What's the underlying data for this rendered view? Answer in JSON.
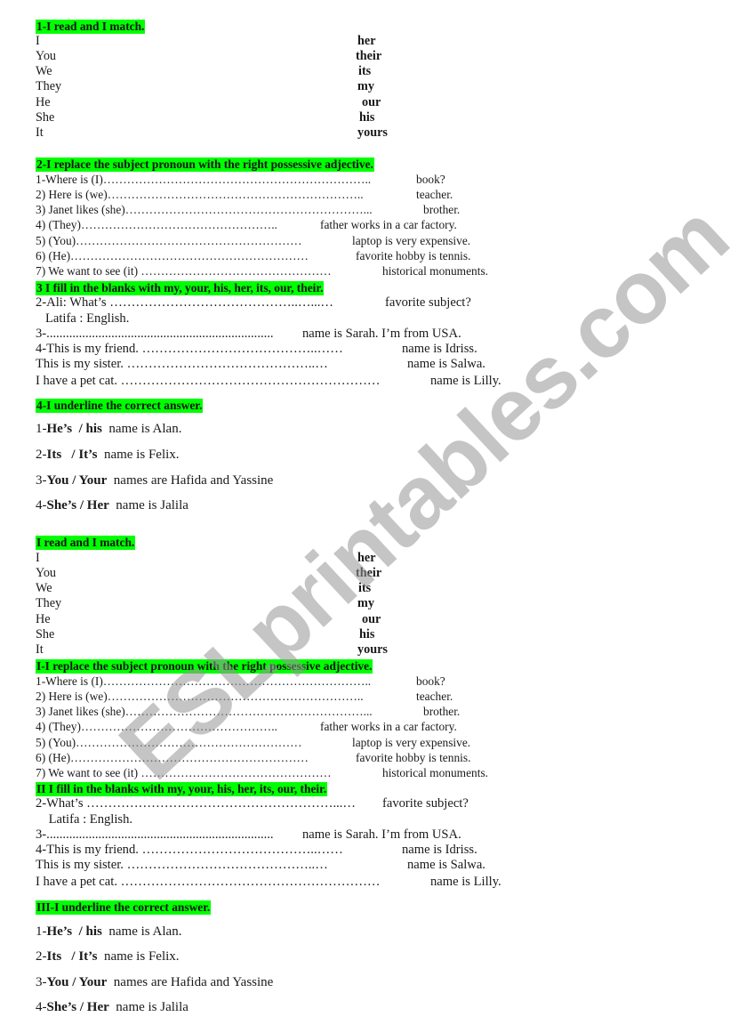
{
  "watermark": "ESLprintables.com",
  "colors": {
    "highlight": "#00ff00",
    "text": "#1a1a1a",
    "watermark": "#a0a0a0"
  },
  "part1": {
    "match": {
      "heading": "1-I read and I match.",
      "subjects": [
        "I",
        "You",
        "We",
        "They",
        "He",
        "She",
        "It"
      ],
      "possessives": [
        "her",
        "their",
        "its",
        "my",
        "our",
        "his",
        "yours"
      ]
    },
    "replace": {
      "heading": "2-I replace the subject pronoun with the right possessive adjective.",
      "items": [
        {
          "prompt": "  1-Where is (I)",
          "blank": "…………………………………………………………..",
          "end": "book?"
        },
        {
          "prompt": "2) Here is (we)",
          "blank": "………………………………………………………..",
          "end": "teacher."
        },
        {
          "prompt": "3) Janet likes (she)",
          "blank": "……………………………………………………...",
          "end": "brother."
        },
        {
          "prompt": "4) (They)",
          "blank": "…………………………………………..",
          "end": "father works in a car factory."
        },
        {
          "prompt": "5) (You)",
          "blank": "…………………………………………………",
          "end": "laptop is very expensive."
        },
        {
          "prompt": "6) (He)",
          "blank": "……………………………………………………",
          "end": "favorite hobby is tennis."
        },
        {
          "prompt": " 7) We want to see (it) ",
          "blank": "…………………………………………",
          "end": "historical monuments."
        }
      ]
    },
    "fill": {
      "heading": "3 I fill in the blanks with my, your, his, her, its, our, their.",
      "items": [
        {
          "prompt": "2-Ali: What’s ",
          "blank": "……………………………………..…...…",
          "end": " favorite subject?"
        },
        {
          "prompt": "   Latifa : English.",
          "blank": "",
          "end": ""
        },
        {
          "prompt": "3-",
          "blank": "......................................................................",
          "end": " name is Sarah. I’m from USA."
        },
        {
          "prompt": "4-This is my friend. ",
          "blank": "…………………………………..……",
          "end": " name is Idriss."
        },
        {
          "prompt": "This is my sister. ",
          "blank": "……………………………………..…",
          "end": "name is Salwa."
        },
        {
          "prompt": "I have a pet cat. ",
          "blank": "……………………………………………………",
          "end": " name is Lilly."
        }
      ]
    },
    "underline": {
      "heading": "4-I underline the correct answer.",
      "items": [
        {
          "num": "1-",
          "choice": "He’s  / his",
          "rest": "  name is Alan."
        },
        {
          "num": "2-",
          "choice": "Its   / It’s",
          "rest": "  name is Felix."
        },
        {
          "num": "3-",
          "choice": "You / Your",
          "rest": "  names are Hafida and Yassine"
        },
        {
          "num": "4-",
          "choice": "She’s / Her",
          "rest": "  name is Jalila"
        }
      ]
    }
  },
  "part2": {
    "match": {
      "heading": "I read and I match.",
      "subjects": [
        "I",
        "You",
        "We",
        "They",
        "He",
        "She",
        "It"
      ],
      "possessives": [
        "her",
        "their",
        "its",
        "my",
        "our",
        "his",
        "yours"
      ]
    },
    "replace": {
      "heading": "I-I replace the subject pronoun with the right possessive adjective.",
      "items": [
        {
          "prompt": "  1-Where is (I)",
          "blank": "…………………………………………………………..",
          "end": "book?"
        },
        {
          "prompt": "2) Here is (we)",
          "blank": "………………………………………………………..",
          "end": "teacher."
        },
        {
          "prompt": "3) Janet likes (she)",
          "blank": "……………………………………………………...",
          "end": "brother."
        },
        {
          "prompt": "4) (They)",
          "blank": "…………………………………………..",
          "end": "father works in a car factory."
        },
        {
          "prompt": "5) (You)",
          "blank": "…………………………………………………",
          "end": "laptop is very expensive."
        },
        {
          "prompt": "6) (He)",
          "blank": "……………………………………………………",
          "end": "favorite hobby is tennis."
        },
        {
          "prompt": " 7) We want to see (it) ",
          "blank": "…………………………………………",
          "end": "historical monuments."
        }
      ]
    },
    "fill": {
      "heading": "II I fill in the blanks with my, your, his, her, its, our, their.",
      "items": [
        {
          "prompt": "2-What’s ",
          "blank": "…………………………………………………...…",
          "end": " favorite subject?"
        },
        {
          "prompt": "    Latifa : English.",
          "blank": "",
          "end": ""
        },
        {
          "prompt": "3-",
          "blank": "......................................................................",
          "end": " name is Sarah. I’m from USA."
        },
        {
          "prompt": "4-This is my friend. ",
          "blank": "…………………………………..……",
          "end": " name is Idriss."
        },
        {
          "prompt": "This is my sister. ",
          "blank": "……………………………………..…",
          "end": "name is Salwa."
        },
        {
          "prompt": "I have a pet cat. ",
          "blank": "……………………………………………………",
          "end": " name is Lilly."
        }
      ]
    },
    "underline": {
      "heading": "III-I underline the correct answer.",
      "items": [
        {
          "num": "1-",
          "choice": "He’s  / his",
          "rest": "  name is Alan."
        },
        {
          "num": "2-",
          "choice": "Its   / It’s",
          "rest": "  name is Felix."
        },
        {
          "num": "3-",
          "choice": "You / Your",
          "rest": "  names are Hafida and Yassine"
        },
        {
          "num": "4-",
          "choice": "She’s / Her",
          "rest": "  name is Jalila"
        }
      ]
    }
  }
}
